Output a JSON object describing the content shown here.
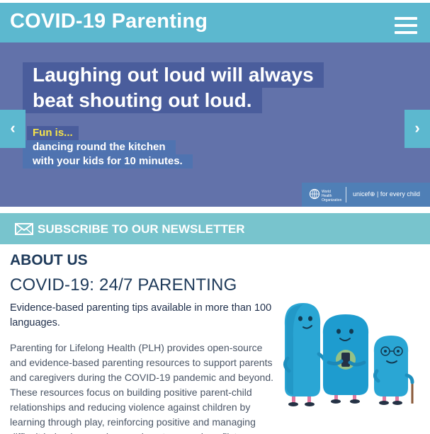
{
  "header": {
    "title": "COVID-19 Parenting",
    "menu_icon": "hamburger-menu-icon"
  },
  "slider": {
    "headline_line1": "Laughing out loud will always",
    "headline_line2": "beat shouting out loud.",
    "tip_label": "Fun is...",
    "tip_line1": "dancing round the kitchen",
    "tip_line2": "with your kids for 10 minutes.",
    "prev_arrow": "‹",
    "next_arrow": "›",
    "partner_who": "World Health Organization",
    "partner_unicef": "unicef⊕ | for every child"
  },
  "newsletter": {
    "label": "SUBSCRIBE TO OUR NEWSLETTER",
    "icon": "envelope-icon"
  },
  "about": {
    "heading": "ABOUT US",
    "title": "COVID-19: 24/7 PARENTING",
    "lead": "Evidence-based parenting tips available in more than 100 languages.",
    "body": "Parenting for Lifelong Health (PLH) provides open-source and evidence-based parenting resources to support parents and caregivers during the COVID-19 pandemic and beyond. These resources focus on building positive parent-child relationships and reducing violence against children by learning through play, reinforcing positive and managing difficult behaviour, and managing stress and conflict."
  },
  "colors": {
    "header_bg": "#5cb8cf",
    "slider_bg": "#6272aa",
    "newsletter_bg": "#78c4cd",
    "heading_text": "#1e3a5a",
    "highlight": "#f6e34a"
  }
}
